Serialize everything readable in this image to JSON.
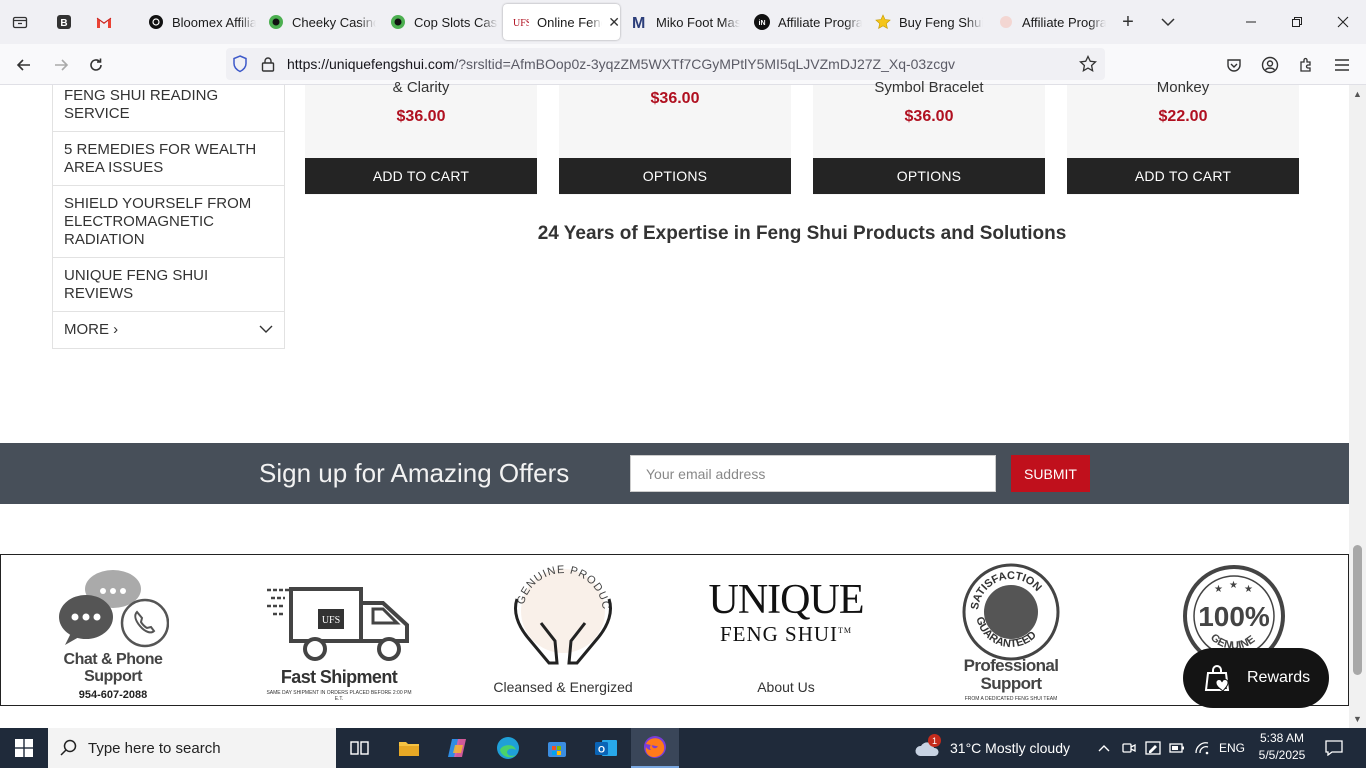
{
  "browser": {
    "tabs": [
      {
        "title": "Bloomex Affilia",
        "favicon": "bloomex-icon"
      },
      {
        "title": "Cheeky Casino",
        "favicon": "casino-icon"
      },
      {
        "title": "Cop Slots Casi",
        "favicon": "casino-icon"
      },
      {
        "title": "Online Feng",
        "favicon": "ufs-icon",
        "active": true
      },
      {
        "title": "Miko Foot Mas",
        "favicon": "miko-icon"
      },
      {
        "title": "Affiliate Progra",
        "favicon": "in-icon"
      },
      {
        "title": "Buy Feng Shui",
        "favicon": "star-icon"
      },
      {
        "title": "Affiliate Progra",
        "favicon": "generic-icon"
      }
    ],
    "url_domain": "https://uniquefengshui.com",
    "url_rest": "/?srsltid=AfmBOop0z-3yqzZM5WXTf7CGyMPtlY5MI5qLJVZmDJ27Z_Xq-03zcgv"
  },
  "sidebar": {
    "items": [
      {
        "label": "FENG SHUI READING SERVICE"
      },
      {
        "label": "5 REMEDIES FOR WEALTH AREA ISSUES"
      },
      {
        "label": "SHIELD YOURSELF FROM ELECTROMAGNETIC RADIATION"
      },
      {
        "label": "UNIQUE FENG SHUI REVIEWS"
      }
    ],
    "more_label": "MORE ›"
  },
  "products": [
    {
      "name": "& Clarity",
      "price": "$36.00",
      "cta": "ADD TO CART"
    },
    {
      "name": "",
      "price": "$36.00",
      "cta": "OPTIONS"
    },
    {
      "name": "Symbol Bracelet",
      "price": "$36.00",
      "cta": "OPTIONS"
    },
    {
      "name": "Monkey",
      "price": "$22.00",
      "cta": "ADD TO CART"
    }
  ],
  "expertise_heading": "24 Years of Expertise in Feng Shui Products and Solutions",
  "signup": {
    "title": "Sign up for Amazing Offers",
    "email_placeholder": "Your email address",
    "submit_label": "SUBMIT"
  },
  "badges": {
    "chat_line1": "Chat & Phone",
    "chat_line2": "Support",
    "chat_phone": "954-607-2088",
    "ship_title": "Fast Shipment",
    "ship_sub": "SAME DAY SHIPMENT IN ORDERS PLACED BEFORE 2:00 PM E.T.",
    "ship_logo": "UFS",
    "genuine_arc": "GENUINE PRODUCTS",
    "genuine_caption": "Cleansed & Energized",
    "logo_line1": "UNIQUE",
    "logo_line2": "FENG SHUI",
    "logo_tm": "TM",
    "about_label": "About Us",
    "satisfaction_arc_top": "SATISFACTION",
    "satisfaction_arc_bottom": "GUARANTEED",
    "pro_line1": "Professional",
    "pro_line2": "Support",
    "pro_sub": "FROM A DEDICATED FENG SHUI TEAM",
    "hundred": "100%",
    "hundred_arc": "GENUINE"
  },
  "rewards_label": "Rewards",
  "taskbar": {
    "search_placeholder": "Type here to search",
    "weather_badge": "1",
    "weather": "31°C  Mostly cloudy",
    "lang": "ENG",
    "time": "5:38 AM",
    "date": "5/5/2025"
  },
  "colors": {
    "price_red": "#b01020",
    "submit_red": "#c0101c",
    "signup_band": "#474f59",
    "cta_dark": "#242424",
    "taskbar": "#1f2a3a"
  }
}
